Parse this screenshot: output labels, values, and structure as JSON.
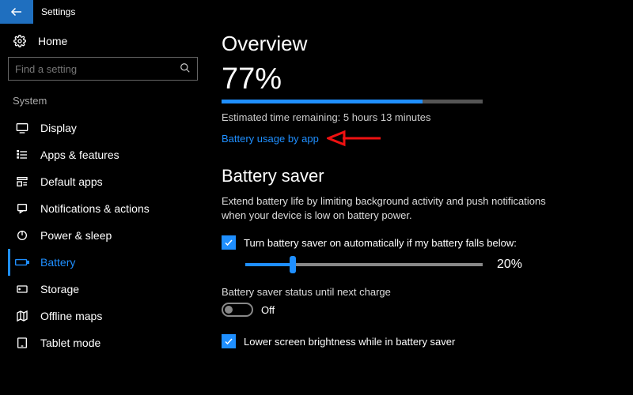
{
  "app": {
    "title": "Settings"
  },
  "sidebar": {
    "home": "Home",
    "search_placeholder": "Find a setting",
    "group": "System",
    "items": [
      {
        "label": "Display"
      },
      {
        "label": "Apps & features"
      },
      {
        "label": "Default apps"
      },
      {
        "label": "Notifications & actions"
      },
      {
        "label": "Power & sleep"
      },
      {
        "label": "Battery"
      },
      {
        "label": "Storage"
      },
      {
        "label": "Offline maps"
      },
      {
        "label": "Tablet mode"
      }
    ]
  },
  "content": {
    "overview_heading": "Overview",
    "battery_percent": "77%",
    "battery_fill_pct": 77,
    "eta": "Estimated time remaining: 5 hours 13 minutes",
    "usage_link": "Battery usage by app",
    "saver_heading": "Battery saver",
    "saver_desc": "Extend battery life by limiting background activity and push notifications when your device is low on battery power.",
    "auto_check_label": "Turn battery saver on automatically if my battery falls below:",
    "slider_value": "20%",
    "slider_fill_pct": 20,
    "status_label": "Battery saver status until next charge",
    "toggle_state": "Off",
    "brightness_check_label": "Lower screen brightness while in battery saver"
  }
}
